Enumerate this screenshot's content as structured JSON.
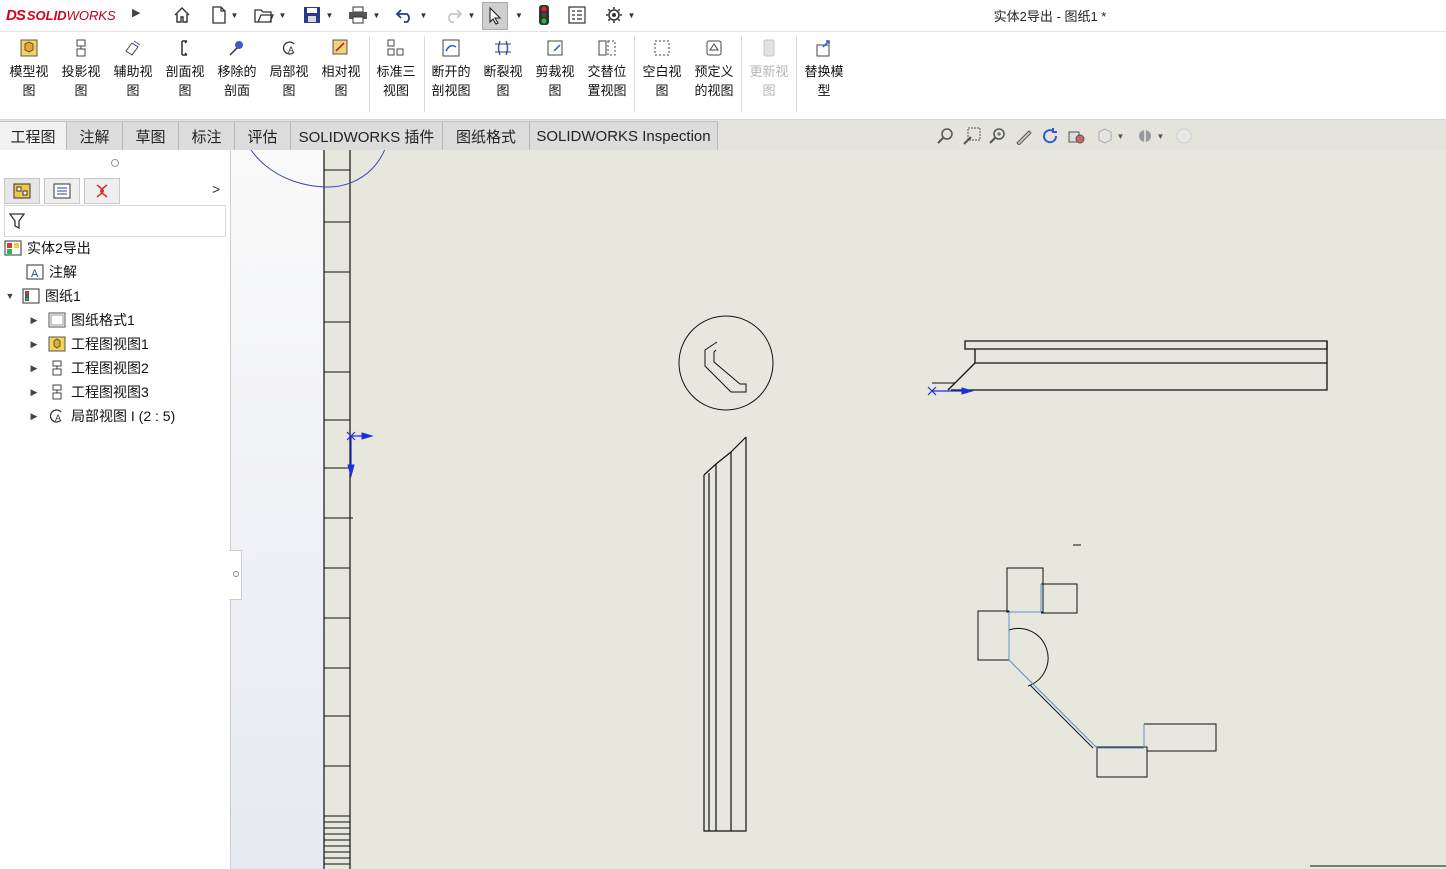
{
  "titlebar": {
    "logo_ds": "DS",
    "logo_solid": "SOLID",
    "logo_works": "WORKS",
    "document_title": "实体2导出 - 图纸1 *"
  },
  "quick_access": [
    "home-icon",
    "new-document-icon",
    "open-icon",
    "save-icon",
    "print-icon",
    "undo-icon",
    "redo-icon",
    "select-icon",
    "traffic-light-icon",
    "file-properties-icon",
    "options-icon"
  ],
  "ribbon": {
    "tools": [
      {
        "label": "模型视\n图",
        "icon": "model-view-icon"
      },
      {
        "label": "投影视\n图",
        "icon": "projected-view-icon"
      },
      {
        "label": "辅助视\n图",
        "icon": "auxiliary-view-icon"
      },
      {
        "label": "剖面视\n图",
        "icon": "section-view-icon"
      },
      {
        "label": "移除的\n剖面",
        "icon": "removed-section-icon"
      },
      {
        "label": "局部视\n图",
        "icon": "detail-view-icon"
      },
      {
        "label": "相对视\n图",
        "icon": "relative-view-icon"
      },
      {
        "label": "标准三\n视图",
        "icon": "standard-3-view-icon"
      },
      {
        "label": "断开的\n剖视图",
        "icon": "broken-out-section-icon"
      },
      {
        "label": "断裂视\n图",
        "icon": "break-view-icon"
      },
      {
        "label": "剪裁视\n图",
        "icon": "crop-view-icon"
      },
      {
        "label": "交替位\n置视图",
        "icon": "alternate-position-icon"
      },
      {
        "label": "空白视\n图",
        "icon": "empty-view-icon"
      },
      {
        "label": "预定义\n的视图",
        "icon": "predefined-view-icon"
      },
      {
        "label": "更新视\n图",
        "icon": "update-view-icon"
      },
      {
        "label": "替换模\n型",
        "icon": "replace-model-icon"
      }
    ]
  },
  "tabs": [
    "工程图",
    "注解",
    "草图",
    "标注",
    "评估",
    "SOLIDWORKS 插件",
    "图纸格式",
    "SOLIDWORKS Inspection"
  ],
  "view_toolbar": [
    "zoom-to-fit-icon",
    "zoom-area-icon",
    "zoom-in-out-icon",
    "sketch-icon",
    "rotate-icon",
    "display-style-icon",
    "hide-show-icon",
    "appearance-icon",
    "scene-icon"
  ],
  "tree": {
    "root": "实体2导出",
    "annotations": "注解",
    "sheet": "图纸1",
    "children": [
      "图纸格式1",
      "工程图视图1",
      "工程图视图2",
      "工程图视图3",
      "局部视图 I (2 : 5)"
    ]
  },
  "colors": {
    "brand": "#d5001c",
    "sheet_bg": "#e8e7dd",
    "annotation_ink": "#3a45c8",
    "view_origin": "#1a2ee0"
  }
}
